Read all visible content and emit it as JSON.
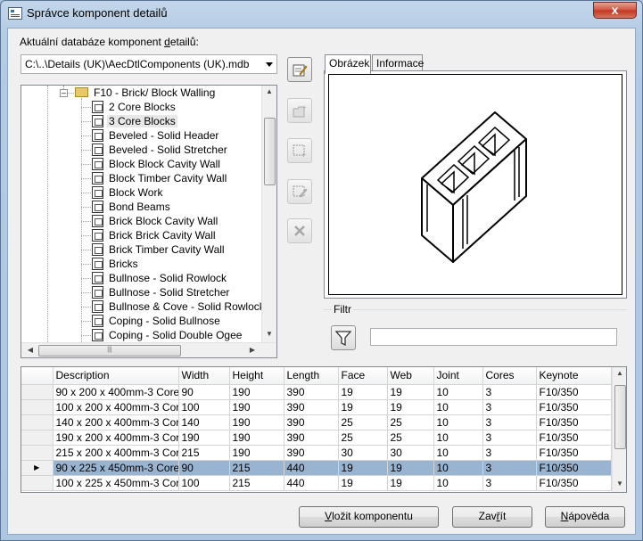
{
  "window": {
    "title": "Správce komponent detailů",
    "close_glyph": "x"
  },
  "database": {
    "label_prefix": "Aktuální databáze komponent ",
    "label_underlined": "d",
    "label_suffix": "etailů:",
    "selected": "C:\\..\\Details (UK)\\AecDtlComponents (UK).mdb"
  },
  "tree": {
    "parent": "F10 - Brick/ Block Walling",
    "items": [
      "2 Core Blocks",
      "3 Core Blocks",
      "Beveled - Solid Header",
      "Beveled - Solid Stretcher",
      "Block Block Cavity Wall",
      "Block Timber Cavity Wall",
      "Block Work",
      "Bond Beams",
      "Brick Block Cavity Wall",
      "Brick Brick Cavity Wall",
      "Brick Timber Cavity Wall",
      "Bricks",
      "Bullnose - Solid Rowlock",
      "Bullnose - Solid Stretcher",
      "Bullnose & Cove - Solid Rowlock",
      "Coping - Solid Bullnose",
      "Coping - Solid Double Ogee"
    ],
    "selected_index": 1
  },
  "toolbar": {
    "icons": [
      "edit-database-icon",
      "new-folder-icon",
      "new-component-icon",
      "edit-component-icon",
      "delete-icon"
    ]
  },
  "tabs": [
    {
      "label": "Obrázek",
      "active": true
    },
    {
      "label": "Informace",
      "active": false
    }
  ],
  "filter": {
    "label": "Filtr",
    "value": ""
  },
  "grid": {
    "columns": [
      "Description",
      "Width",
      "Height",
      "Length",
      "Face",
      "Web",
      "Joint",
      "Cores",
      "Keynote"
    ],
    "rows": [
      [
        "90 x 200 x 400mm-3 Core",
        "90",
        "190",
        "390",
        "19",
        "19",
        "10",
        "3",
        "F10/350"
      ],
      [
        "100 x 200 x 400mm-3 Cor",
        "100",
        "190",
        "390",
        "19",
        "19",
        "10",
        "3",
        "F10/350"
      ],
      [
        "140 x 200 x 400mm-3 Cor",
        "140",
        "190",
        "390",
        "25",
        "25",
        "10",
        "3",
        "F10/350"
      ],
      [
        "190 x 200 x 400mm-3 Cor",
        "190",
        "190",
        "390",
        "25",
        "25",
        "10",
        "3",
        "F10/350"
      ],
      [
        "215 x 200 x 400mm-3 Cor",
        "215",
        "190",
        "390",
        "30",
        "30",
        "10",
        "3",
        "F10/350"
      ],
      [
        "90 x 225 x 450mm-3 Core",
        "90",
        "215",
        "440",
        "19",
        "19",
        "10",
        "3",
        "F10/350"
      ],
      [
        "100 x 225 x 450mm-3 Cor",
        "100",
        "215",
        "440",
        "19",
        "19",
        "10",
        "3",
        "F10/350"
      ]
    ],
    "selected_index": 5,
    "row_marker": "▶"
  },
  "buttons": {
    "insert": {
      "u": "V",
      "rest": "ložit komponentu"
    },
    "close": {
      "pre": "Zav",
      "u": "ř",
      "rest": "ít"
    },
    "help": {
      "u": "N",
      "rest": "ápověda"
    }
  }
}
